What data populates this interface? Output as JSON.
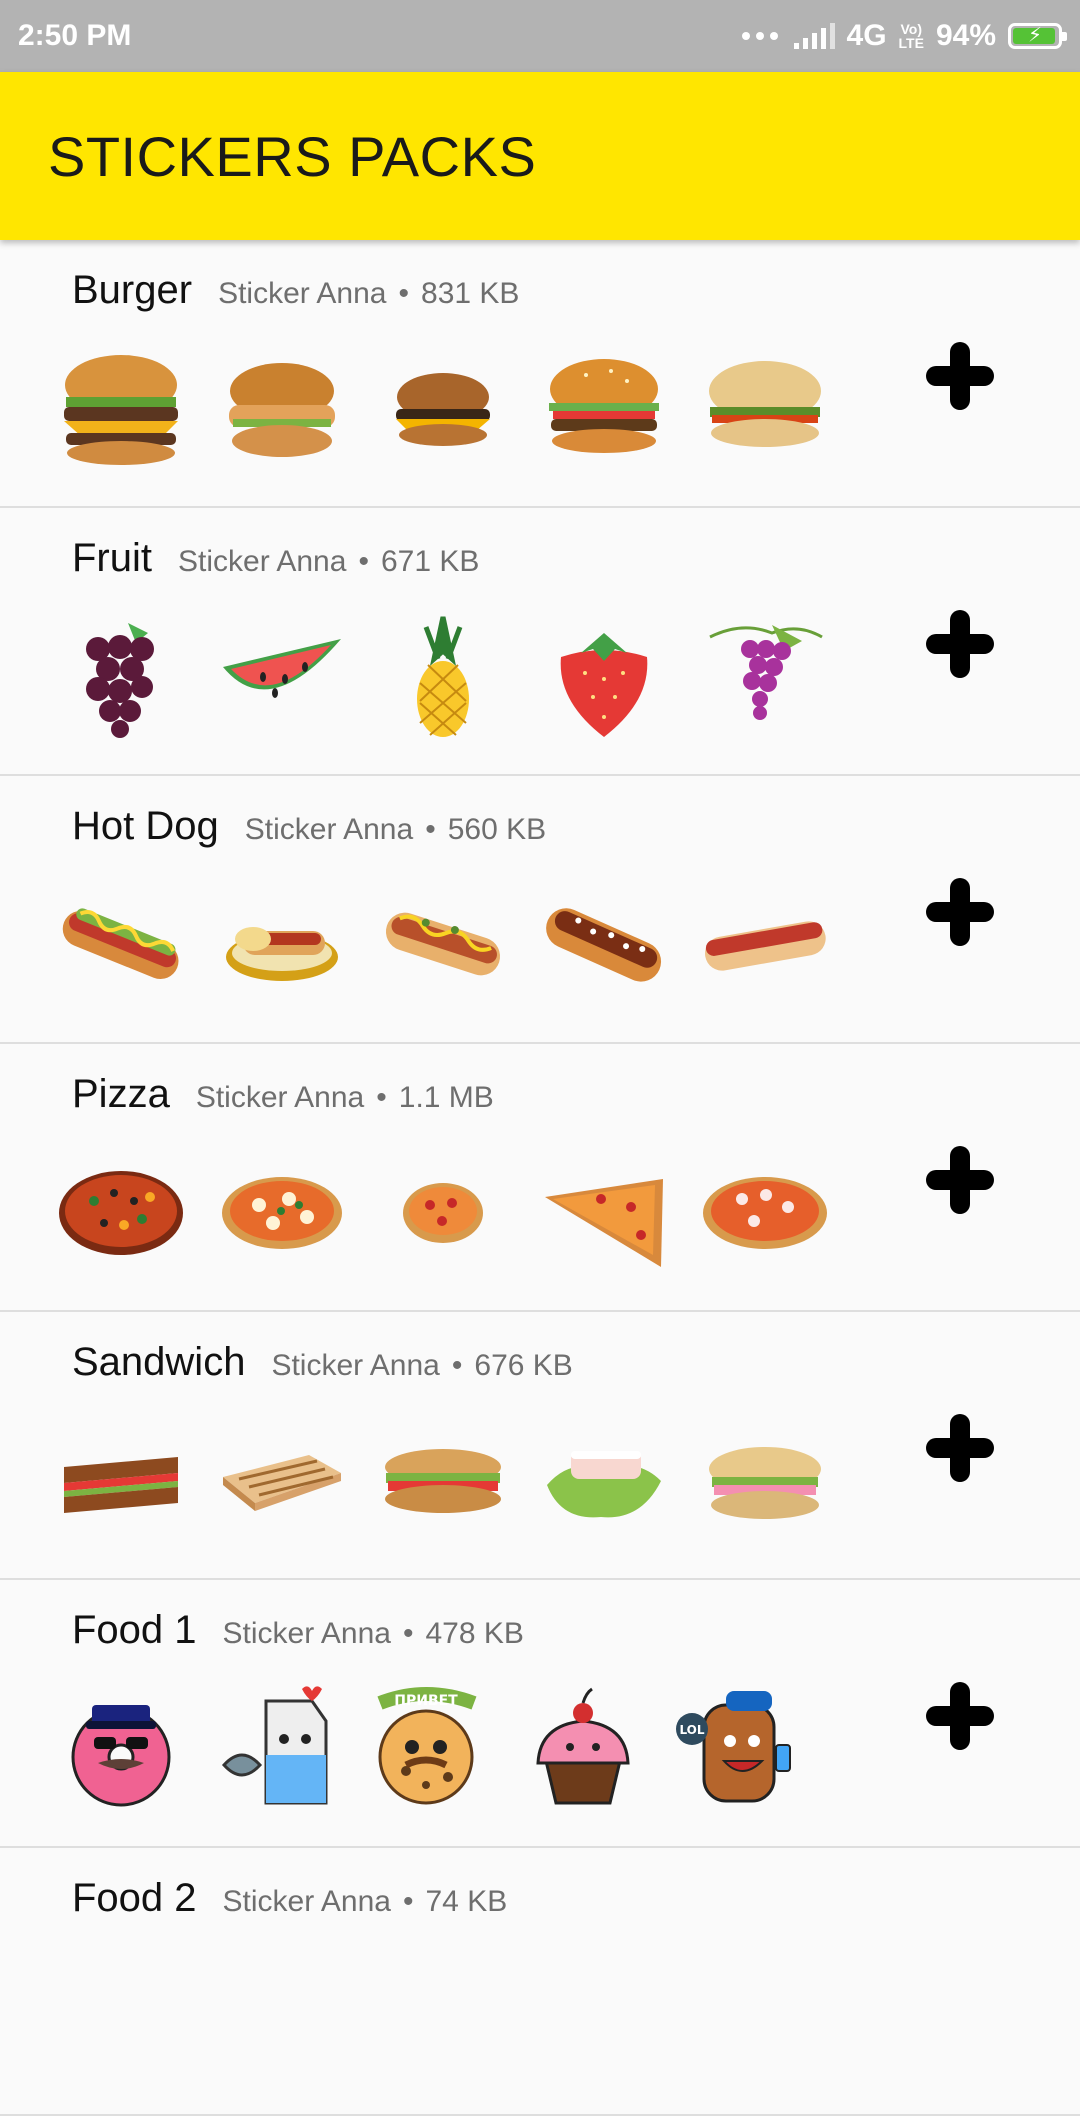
{
  "status": {
    "time": "2:50 PM",
    "network": "4G",
    "volte_top": "Vo)",
    "volte_bottom": "LTE",
    "battery": "94%"
  },
  "appbar": {
    "title": "STICKERS PACKS"
  },
  "colors": {
    "accent": "#ffe600",
    "status_bar": "#b3b3b3",
    "battery_fill": "#55c236"
  },
  "packs": [
    {
      "name": "Burger",
      "author": "Sticker Anna",
      "separator": "•",
      "size": "831 KB",
      "stickers": [
        "burger-double-cheese",
        "chicken-burger",
        "cheeseburger",
        "classic-burger",
        "ciabatta-burger"
      ]
    },
    {
      "name": "Fruit",
      "author": "Sticker Anna",
      "separator": "•",
      "size": "671 KB",
      "stickers": [
        "grapes-dark",
        "watermelon-slice",
        "pineapple",
        "strawberry",
        "grapes-purple"
      ]
    },
    {
      "name": "Hot Dog",
      "author": "Sticker Anna",
      "separator": "•",
      "size": "560 KB",
      "stickers": [
        "hotdog-relish",
        "hotdog-plate",
        "hotdog-toppings",
        "hotdog-chili",
        "hotdog-plain"
      ]
    },
    {
      "name": "Pizza",
      "author": "Sticker Anna",
      "separator": "•",
      "size": "1.1 MB",
      "stickers": [
        "pizza-supreme",
        "pizza-margherita",
        "pizza-small",
        "pizza-slice",
        "pizza-seafood"
      ]
    },
    {
      "name": "Sandwich",
      "author": "Sticker Anna",
      "separator": "•",
      "size": "676 KB",
      "stickers": [
        "sandwich-club",
        "sandwich-grilled",
        "sandwich-sub",
        "sandwich-lettuce",
        "sandwich-baguette"
      ]
    },
    {
      "name": "Food 1",
      "author": "Sticker Anna",
      "separator": "•",
      "size": "478 KB",
      "stickers": [
        "donut-police",
        "milk-carton-fish",
        "cookie-privet",
        "cupcake-cherry",
        "toast-lol"
      ],
      "sticker_texts": {
        "cookie": "ПРИВЕТ",
        "toast": "LOL"
      }
    },
    {
      "name": "Food 2",
      "author": "Sticker Anna",
      "separator": "•",
      "size": "74 KB",
      "stickers": []
    }
  ]
}
